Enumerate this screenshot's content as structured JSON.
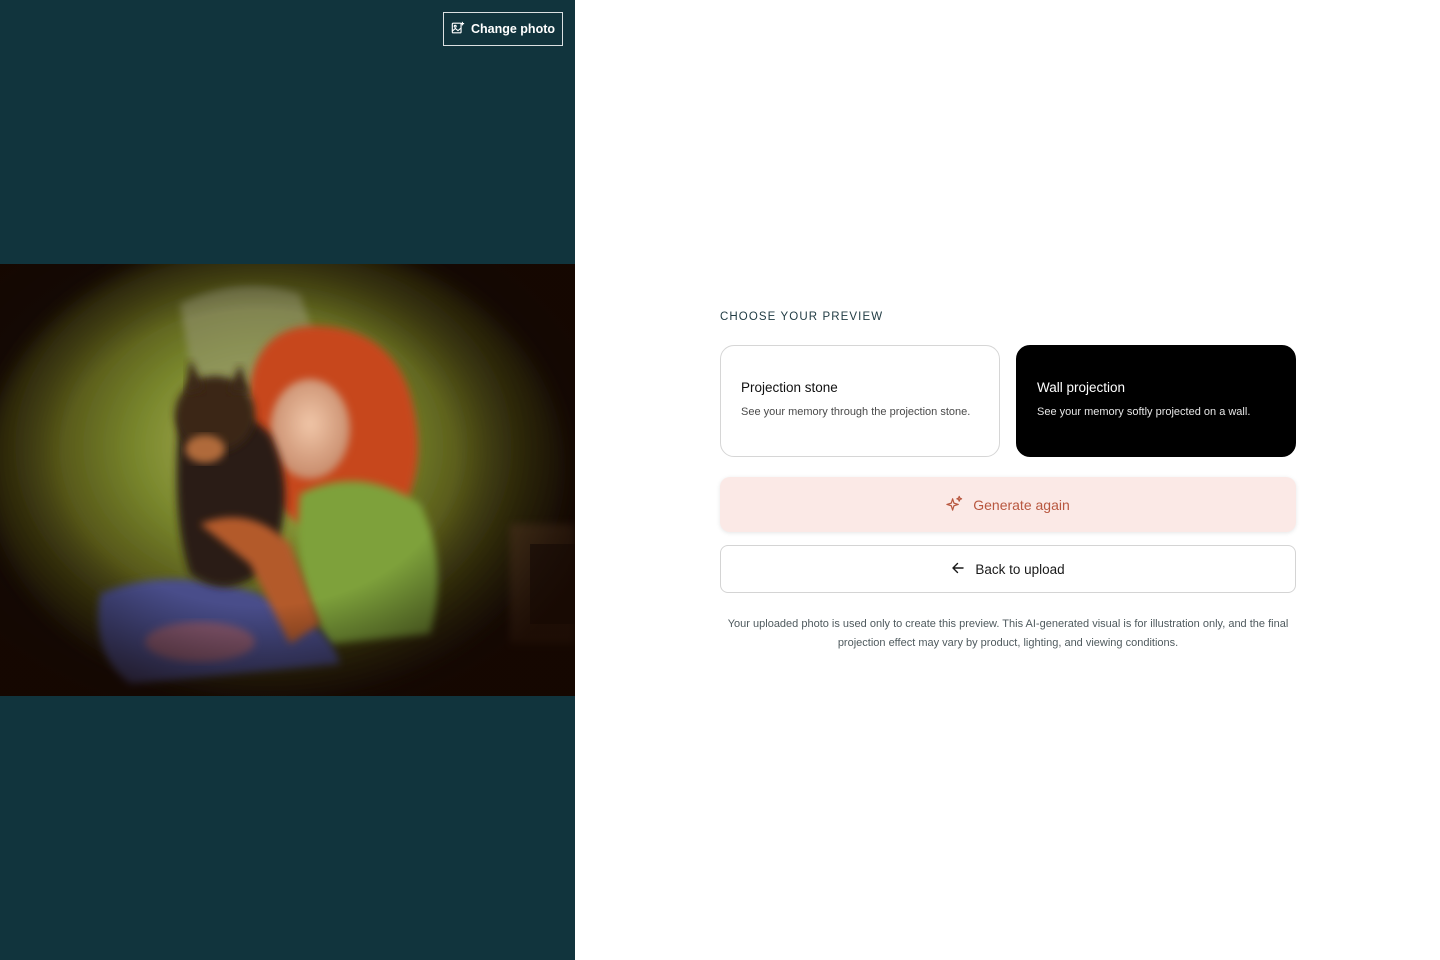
{
  "preview": {
    "change_photo_label": "Change photo",
    "image_alt": "Projected photo of a woman with red hair hugging a dog"
  },
  "chooser": {
    "section_label": "CHOOSE YOUR PREVIEW",
    "options": [
      {
        "title": "Projection stone",
        "description": "See your memory through the projection stone.",
        "selected": false
      },
      {
        "title": "Wall projection",
        "description": "See your memory softly projected on a wall.",
        "selected": true
      }
    ]
  },
  "actions": {
    "generate_label": "Generate again",
    "back_label": "Back to upload"
  },
  "disclaimer": "Your uploaded photo is used only to create this preview. This AI-generated visual is for illustration only, and the final projection effect may vary by product, lighting, and viewing conditions.",
  "colors": {
    "left_panel_bg": "#11343d",
    "selected_card_bg": "#000000",
    "generate_bg": "#fbe9e6",
    "generate_text": "#b8573f"
  },
  "icons": {
    "change_photo": "image-edit-icon",
    "generate": "sparkles-icon",
    "back": "arrow-left-icon"
  }
}
